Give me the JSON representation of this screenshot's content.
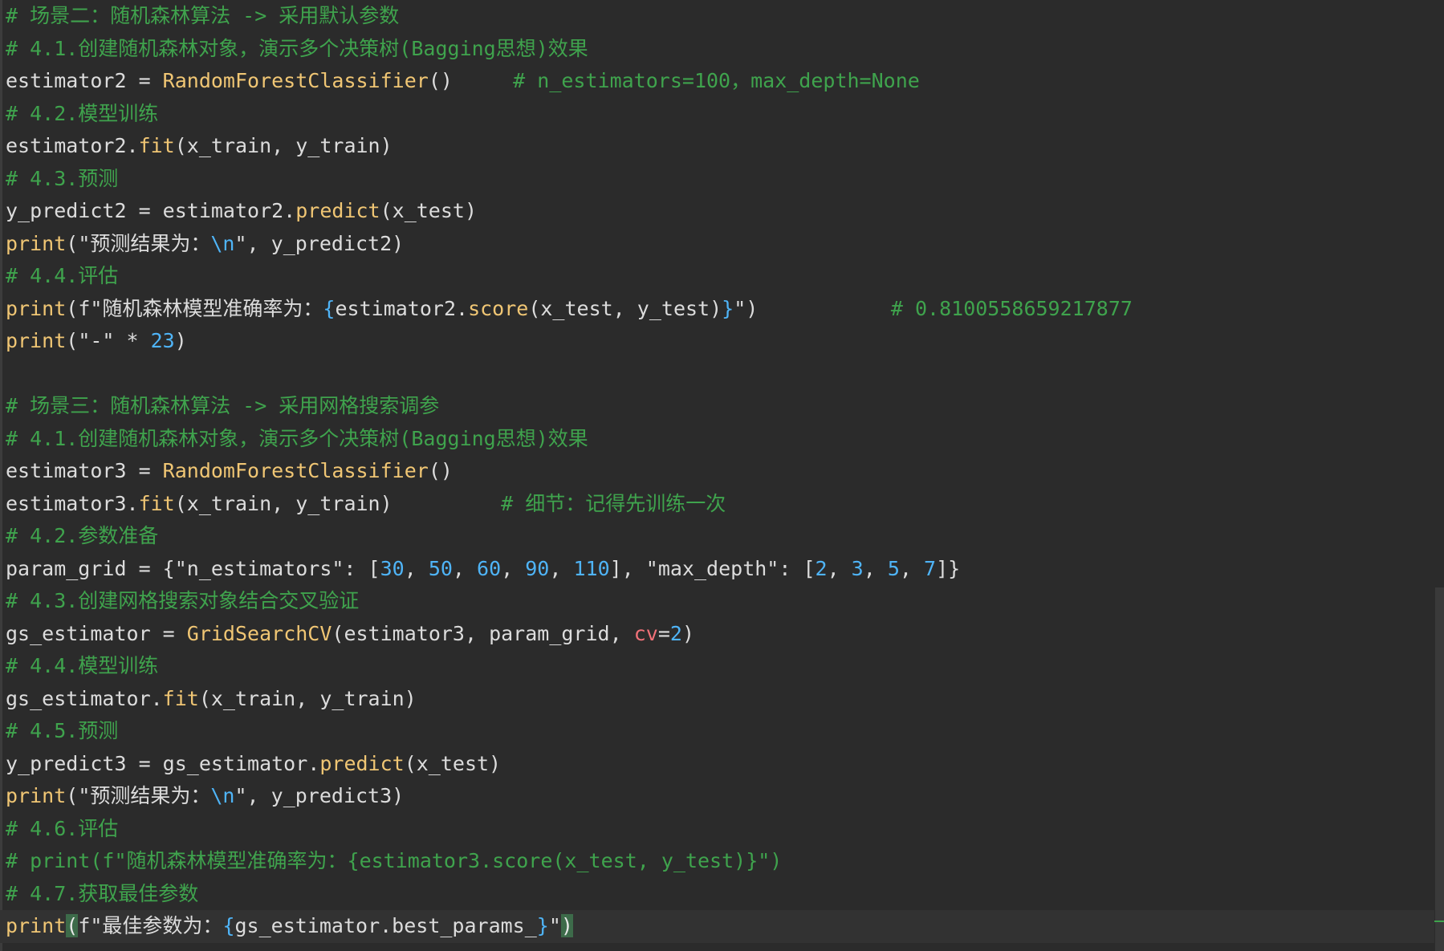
{
  "editor": {
    "lines": [
      [
        {
          "t": "c",
          "v": "# 场景二：随机森林算法 -> 采用默认参数"
        }
      ],
      [
        {
          "t": "c",
          "v": "# 4.1.创建随机森林对象，演示多个决策树(Bagging思想)效果"
        }
      ],
      [
        {
          "t": "d",
          "v": "estimator2 = "
        },
        {
          "t": "f",
          "v": "RandomForestClassifier"
        },
        {
          "t": "d",
          "v": "()     "
        },
        {
          "t": "c",
          "v": "# n_estimators=100，max_depth=None"
        }
      ],
      [
        {
          "t": "c",
          "v": "# 4.2.模型训练"
        }
      ],
      [
        {
          "t": "d",
          "v": "estimator2."
        },
        {
          "t": "f",
          "v": "fit"
        },
        {
          "t": "d",
          "v": "(x_train, y_train)"
        }
      ],
      [
        {
          "t": "c",
          "v": "# 4.3.预测"
        }
      ],
      [
        {
          "t": "d",
          "v": "y_predict2 = estimator2."
        },
        {
          "t": "f",
          "v": "predict"
        },
        {
          "t": "d",
          "v": "(x_test)"
        }
      ],
      [
        {
          "t": "f",
          "v": "print"
        },
        {
          "t": "d",
          "v": "(\"预测结果为："
        },
        {
          "t": "e",
          "v": "\\n"
        },
        {
          "t": "d",
          "v": "\", y_predict2)"
        }
      ],
      [
        {
          "t": "c",
          "v": "# 4.4.评估"
        }
      ],
      [
        {
          "t": "f",
          "v": "print"
        },
        {
          "t": "d",
          "v": "(f\"随机森林模型准确率为："
        },
        {
          "t": "b",
          "v": "{"
        },
        {
          "t": "d",
          "v": "estimator2."
        },
        {
          "t": "f",
          "v": "score"
        },
        {
          "t": "d",
          "v": "(x_test, y_test)"
        },
        {
          "t": "b",
          "v": "}"
        },
        {
          "t": "d",
          "v": "\")           "
        },
        {
          "t": "c",
          "v": "# 0.8100558659217877"
        }
      ],
      [
        {
          "t": "f",
          "v": "print"
        },
        {
          "t": "d",
          "v": "(\"-\" * "
        },
        {
          "t": "n",
          "v": "23"
        },
        {
          "t": "d",
          "v": ")"
        }
      ],
      [
        {
          "t": "d",
          "v": ""
        }
      ],
      [
        {
          "t": "c",
          "v": "# 场景三：随机森林算法 -> 采用网格搜索调参"
        }
      ],
      [
        {
          "t": "c",
          "v": "# 4.1.创建随机森林对象，演示多个决策树(Bagging思想)效果"
        }
      ],
      [
        {
          "t": "d",
          "v": "estimator3 = "
        },
        {
          "t": "f",
          "v": "RandomForestClassifier"
        },
        {
          "t": "d",
          "v": "()"
        }
      ],
      [
        {
          "t": "d",
          "v": "estimator3."
        },
        {
          "t": "f",
          "v": "fit"
        },
        {
          "t": "d",
          "v": "(x_train, y_train)         "
        },
        {
          "t": "c",
          "v": "# 细节：记得先训练一次"
        }
      ],
      [
        {
          "t": "c",
          "v": "# 4.2.参数准备"
        }
      ],
      [
        {
          "t": "d",
          "v": "param_grid = {\"n_estimators\": ["
        },
        {
          "t": "n",
          "v": "30"
        },
        {
          "t": "d",
          "v": ", "
        },
        {
          "t": "n",
          "v": "50"
        },
        {
          "t": "d",
          "v": ", "
        },
        {
          "t": "n",
          "v": "60"
        },
        {
          "t": "d",
          "v": ", "
        },
        {
          "t": "n",
          "v": "90"
        },
        {
          "t": "d",
          "v": ", "
        },
        {
          "t": "n",
          "v": "110"
        },
        {
          "t": "d",
          "v": "], \"max_depth\": ["
        },
        {
          "t": "n",
          "v": "2"
        },
        {
          "t": "d",
          "v": ", "
        },
        {
          "t": "n",
          "v": "3"
        },
        {
          "t": "d",
          "v": ", "
        },
        {
          "t": "n",
          "v": "5"
        },
        {
          "t": "d",
          "v": ", "
        },
        {
          "t": "n",
          "v": "7"
        },
        {
          "t": "d",
          "v": "]}"
        }
      ],
      [
        {
          "t": "c",
          "v": "# 4.3.创建网格搜索对象结合交叉验证"
        }
      ],
      [
        {
          "t": "d",
          "v": "gs_estimator = "
        },
        {
          "t": "f",
          "v": "GridSearchCV"
        },
        {
          "t": "d",
          "v": "(estimator3, param_grid, "
        },
        {
          "t": "k",
          "v": "cv"
        },
        {
          "t": "d",
          "v": "="
        },
        {
          "t": "n",
          "v": "2"
        },
        {
          "t": "d",
          "v": ")"
        }
      ],
      [
        {
          "t": "c",
          "v": "# 4.4.模型训练"
        }
      ],
      [
        {
          "t": "d",
          "v": "gs_estimator."
        },
        {
          "t": "f",
          "v": "fit"
        },
        {
          "t": "d",
          "v": "(x_train, y_train)"
        }
      ],
      [
        {
          "t": "c",
          "v": "# 4.5.预测"
        }
      ],
      [
        {
          "t": "d",
          "v": "y_predict3 = gs_estimator."
        },
        {
          "t": "f",
          "v": "predict"
        },
        {
          "t": "d",
          "v": "(x_test)"
        }
      ],
      [
        {
          "t": "f",
          "v": "print"
        },
        {
          "t": "d",
          "v": "(\"预测结果为："
        },
        {
          "t": "e",
          "v": "\\n"
        },
        {
          "t": "d",
          "v": "\", y_predict3)"
        }
      ],
      [
        {
          "t": "c",
          "v": "# 4.6.评估"
        }
      ],
      [
        {
          "t": "c",
          "v": "# print(f\"随机森林模型准确率为：{estimator3.score(x_test, y_test)}\")"
        }
      ],
      [
        {
          "t": "c",
          "v": "# 4.7.获取最佳参数"
        }
      ],
      [
        {
          "t": "f",
          "v": "print"
        },
        {
          "t": "m",
          "v": "("
        },
        {
          "t": "d",
          "v": "f\"最佳参数为："
        },
        {
          "t": "b",
          "v": "{"
        },
        {
          "t": "d",
          "v": "gs_estimator.best_params_"
        },
        {
          "t": "b",
          "v": "}"
        },
        {
          "t": "d",
          "v": "\""
        },
        {
          "t": "m",
          "v": ")"
        }
      ]
    ],
    "current_line_index": 28
  },
  "colors": {
    "background": "#2b2b2b",
    "comment": "#3fa34d",
    "function": "#f0c674",
    "number": "#4fb4f7",
    "kwarg": "#f07178",
    "text": "#dcdcdc"
  }
}
